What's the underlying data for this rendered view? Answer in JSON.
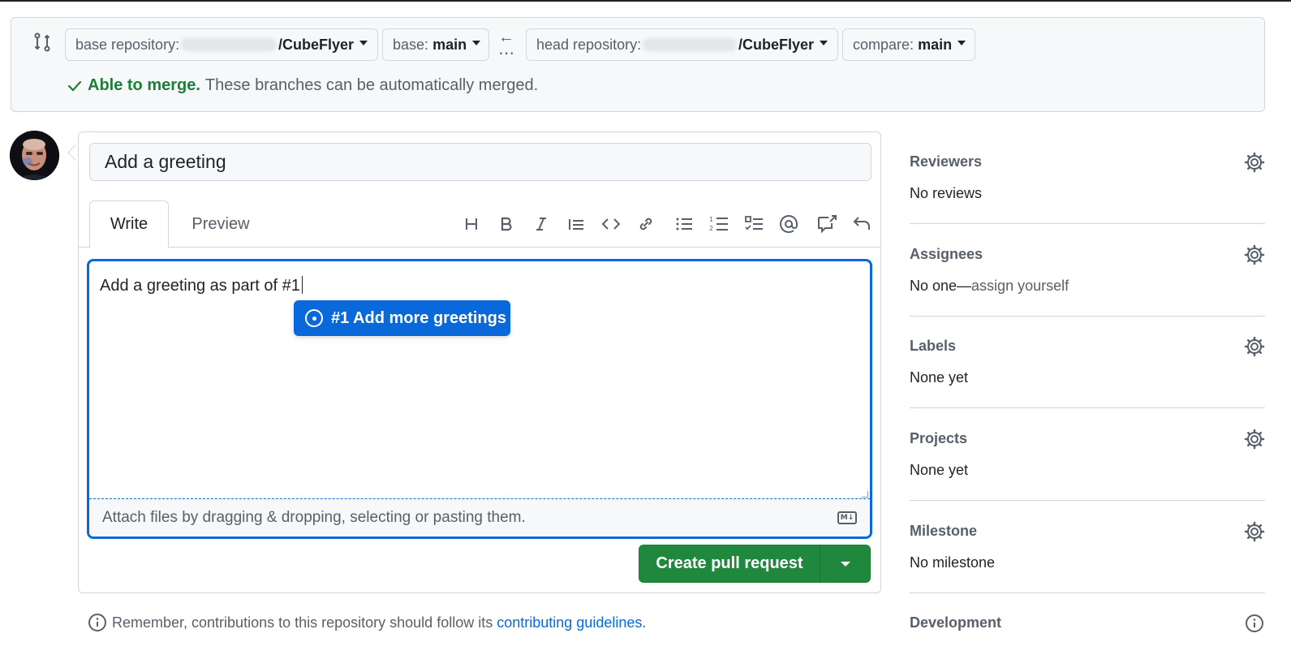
{
  "compare": {
    "base_repo_label": "base repository:",
    "base_repo_name": "/CubeFlyer",
    "base_branch_label": "base:",
    "base_branch": "main",
    "head_repo_label": "head repository:",
    "head_repo_name": "/CubeFlyer",
    "compare_label": "compare:",
    "compare_branch": "main",
    "merge_status": "Able to merge.",
    "merge_message": "These branches can be automatically merged."
  },
  "composer": {
    "title_value": "Add a greeting",
    "tabs": [
      "Write",
      "Preview"
    ],
    "toolbar_icons": [
      "heading-icon",
      "bold-icon",
      "italic-icon",
      "quote-icon",
      "code-icon",
      "link-icon",
      "bulleted-list-icon",
      "numbered-list-icon",
      "task-list-icon",
      "mention-icon",
      "cross-reference-icon",
      "undo-icon"
    ],
    "body_text": "Add a greeting as part of #1",
    "suggestion": "#1 Add more greetings",
    "attach_hint": "Attach files by dragging & dropping, selecting or pasting them.",
    "create_button": "Create pull request"
  },
  "footer": {
    "remember_text": "Remember, contributions to this repository should follow its",
    "guidelines_link": "contributing guidelines",
    "period": "."
  },
  "sidebar": {
    "reviewers": {
      "title": "Reviewers",
      "value": "No reviews"
    },
    "assignees": {
      "title": "Assignees",
      "value": "No one—",
      "link": "assign yourself"
    },
    "labels": {
      "title": "Labels",
      "value": "None yet"
    },
    "projects": {
      "title": "Projects",
      "value": "None yet"
    },
    "milestone": {
      "title": "Milestone",
      "value": "No milestone"
    },
    "development": {
      "title": "Development"
    }
  },
  "colors": {
    "accent": "#0969da",
    "success": "#1a7f37",
    "button_green": "#1f883d",
    "border": "#d0d7de",
    "muted": "#57606a"
  }
}
